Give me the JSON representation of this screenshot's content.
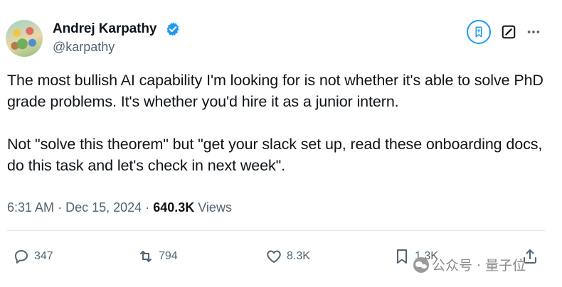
{
  "author": {
    "name": "Andrej Karpathy",
    "handle": "@karpathy",
    "verified_color": "#1d9bf0"
  },
  "header_actions": [
    {
      "icon": "grok-icon"
    },
    {
      "icon": "edit-icon"
    },
    {
      "icon": "more-icon"
    }
  ],
  "tweet": {
    "paragraphs": [
      "The most bullish AI capability I'm looking for is not whether it's able to solve PhD grade problems. It's whether you'd hire it as a junior intern.",
      "Not \"solve this theorem\" but \"get your slack set up, read these onboarding docs, do this task and let's check in next week\"."
    ],
    "time": "6:31 AM",
    "date": "Dec 15, 2024",
    "separator": "·",
    "views_count": "640.3K",
    "views_label": "Views"
  },
  "actions": {
    "replies": "347",
    "retweets": "794",
    "likes": "8.3K",
    "bookmarks": "1.3K"
  },
  "watermark": {
    "text": "公众号 · 量子位"
  },
  "colors": {
    "text": "#0f1419",
    "secondary": "#536471",
    "accent": "#1d9bf0"
  }
}
